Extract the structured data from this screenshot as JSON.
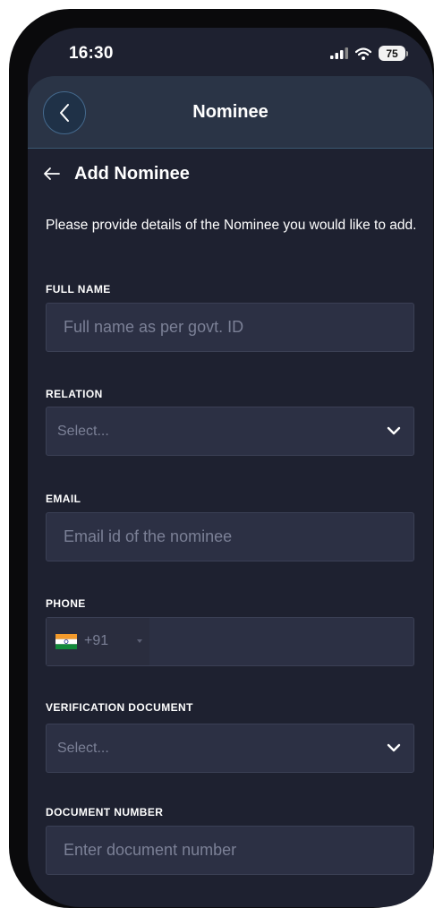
{
  "status_bar": {
    "time": "16:30",
    "battery": "75"
  },
  "header": {
    "title": "Nominee"
  },
  "section": {
    "title": "Add Nominee"
  },
  "intro": "Please provide details of the Nominee you would like to add.",
  "fields": {
    "full_name": {
      "label": "FULL NAME",
      "placeholder": "Full name as per govt. ID"
    },
    "relation": {
      "label": "RELATION",
      "value": "Select..."
    },
    "email": {
      "label": "EMAIL",
      "placeholder": "Email id of the nominee"
    },
    "phone": {
      "label": "PHONE",
      "dial_code": "+91",
      "country_flag": "india-flag-icon"
    },
    "verification_document": {
      "label": "VERIFICATION DOCUMENT",
      "value": "Select..."
    },
    "document_number": {
      "label": "DOCUMENT NUMBER",
      "placeholder": "Enter document number"
    }
  },
  "colors": {
    "background": "#1e2130",
    "header": "#2a3446",
    "field": "#2c3044",
    "text": "#ffffff",
    "placeholder": "#7b8096"
  }
}
